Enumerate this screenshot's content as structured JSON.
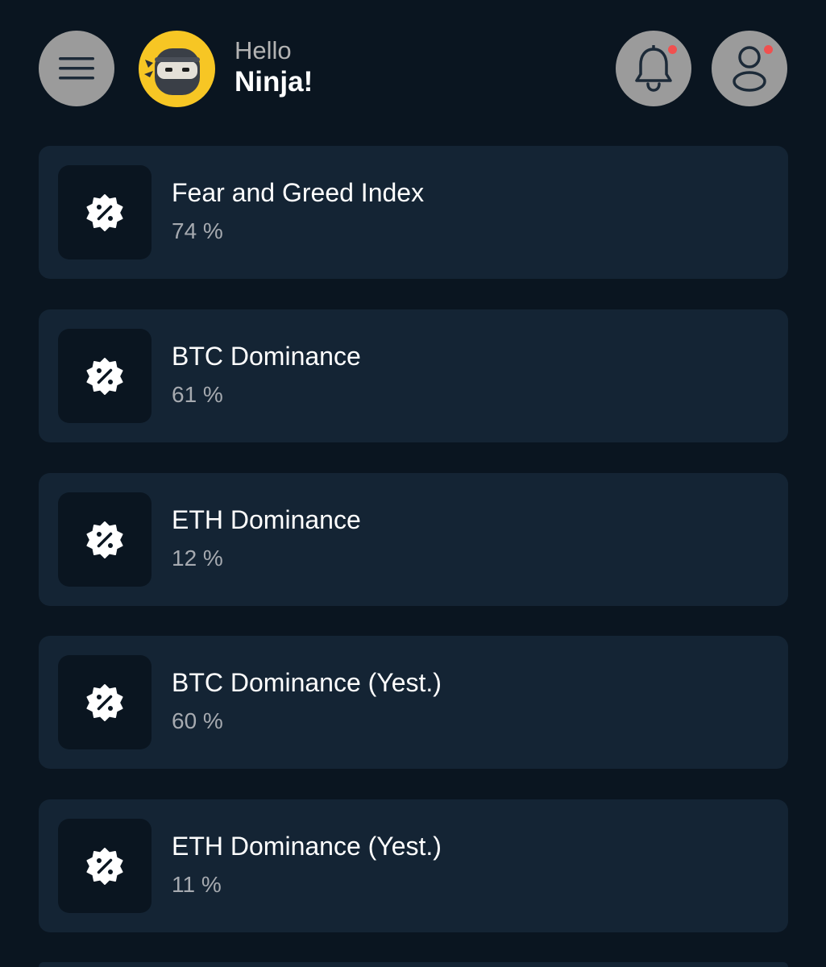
{
  "header": {
    "greeting": "Hello",
    "user_name": "Ninja!",
    "menu_icon": "hamburger-menu-icon",
    "notification_icon": "bell-icon",
    "profile_icon": "user-icon",
    "notification_dot_color": "#f0504f",
    "avatar_color": "#f7c624"
  },
  "cards": [
    {
      "title": "Fear and Greed Index",
      "value": "74 %",
      "icon": "percent-badge-icon"
    },
    {
      "title": "BTC Dominance",
      "value": "61 %",
      "icon": "percent-badge-icon"
    },
    {
      "title": "ETH Dominance",
      "value": "12 %",
      "icon": "percent-badge-icon"
    },
    {
      "title": "BTC Dominance (Yest.)",
      "value": "60 %",
      "icon": "percent-badge-icon"
    },
    {
      "title": "ETH Dominance (Yest.)",
      "value": "11 %",
      "icon": "percent-badge-icon"
    }
  ],
  "colors": {
    "background": "#0a1520",
    "card": "#142434",
    "value_text": "#a6aab0"
  }
}
